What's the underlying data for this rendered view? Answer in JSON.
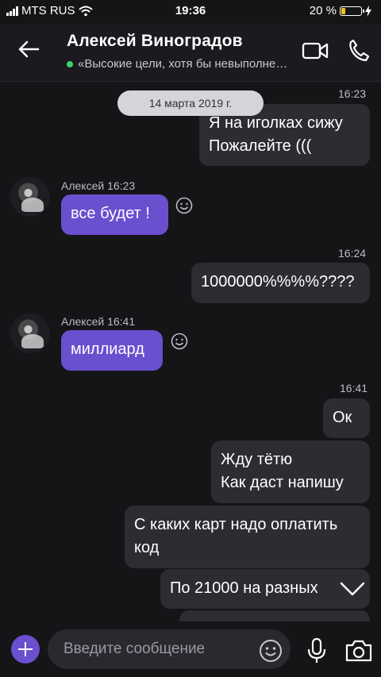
{
  "status_bar": {
    "carrier": "MTS RUS",
    "time": "19:36",
    "battery_percent_label": "20 %",
    "battery_level": 0.2
  },
  "header": {
    "name": "Алексей Виноградов",
    "status": "«Высокие цели, хотя бы невыполне…"
  },
  "date_pill": "14 марта 2019 г.",
  "messages": [
    {
      "type": "out",
      "time": "16:23",
      "lines": [
        "Я на иголках сижу",
        "Пожалейте ((("
      ]
    },
    {
      "type": "in",
      "sender": "Алексей 16:23",
      "text": "все будет !"
    },
    {
      "type": "out",
      "time": "16:24",
      "text": "1000000%%%%????"
    },
    {
      "type": "in",
      "sender": "Алексей 16:41",
      "text": "миллиард"
    },
    {
      "type": "out",
      "time": "16:41",
      "text": "Ок"
    },
    {
      "type": "out",
      "lines": [
        "Жду тётю",
        "Как даст напишу"
      ]
    },
    {
      "type": "out",
      "lines": [
        "С каких карт надо оплатить",
        "код"
      ]
    },
    {
      "type": "out",
      "text": "По 21000 на разных"
    }
  ],
  "input": {
    "placeholder": "Введите сообщение"
  },
  "icons": [
    "back-arrow-icon",
    "video-call-icon",
    "phone-icon",
    "smile-icon",
    "plus-icon",
    "emoji-icon",
    "microphone-icon",
    "camera-icon",
    "chevron-down-icon"
  ],
  "colors": {
    "incoming_bubble": "#6a4fcf",
    "outgoing_bubble": "#2d2c33",
    "online": "#3ad26b",
    "battery": "#f3c316"
  }
}
